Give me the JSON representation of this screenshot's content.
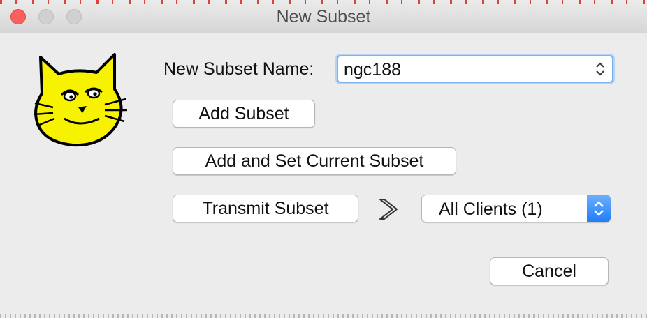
{
  "window": {
    "title": "New Subset"
  },
  "form": {
    "name_label": "New Subset Name:",
    "name_value": "ngc188"
  },
  "buttons": {
    "add_subset": "Add Subset",
    "add_and_set_current": "Add and Set Current Subset",
    "transmit_subset": "Transmit Subset",
    "cancel": "Cancel"
  },
  "transmit_target": {
    "selected": "All Clients (1)"
  },
  "icons": {
    "app_logo": "cat-logo-icon",
    "transmit_arrow": "double-chevron-right-icon"
  },
  "colors": {
    "logo_yellow": "#f7f200",
    "focus_ring": "#7fb1f0",
    "select_accent": "#1f7cf5",
    "close_light": "#fc605c"
  }
}
